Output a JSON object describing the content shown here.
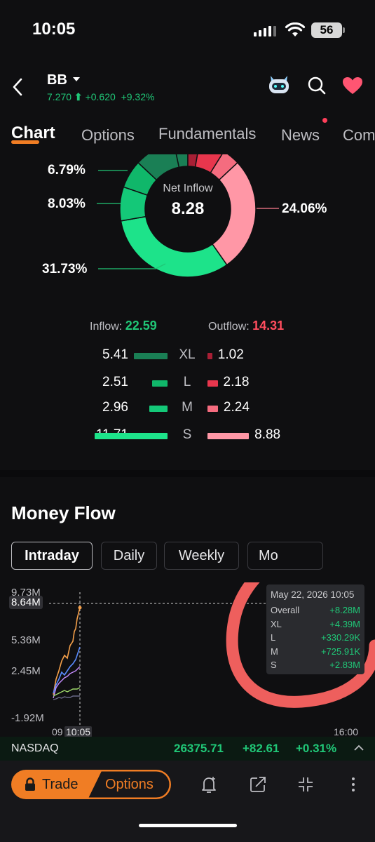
{
  "status": {
    "time": "10:05",
    "battery": "56"
  },
  "header": {
    "ticker": "BB",
    "price": "7.270",
    "change": "+0.620",
    "change_pct": "+9.32%"
  },
  "tabs": [
    {
      "label": "Chart"
    },
    {
      "label": "Options"
    },
    {
      "label": "Fundamentals"
    },
    {
      "label": "News"
    },
    {
      "label": "Com"
    }
  ],
  "donut": {
    "center_label": "Net Inflow",
    "center_value": "8.28",
    "labels": {
      "a": "6.79%",
      "b": "8.03%",
      "c": "31.73%",
      "d": "24.06%"
    }
  },
  "flow": {
    "inflow_label": "Inflow:",
    "inflow_value": "22.59",
    "outflow_label": "Outflow:",
    "outflow_value": "14.31",
    "rows": [
      {
        "in": "5.41",
        "cat": "XL",
        "out": "1.02",
        "in_v": 5.41,
        "out_v": 1.02
      },
      {
        "in": "2.51",
        "cat": "L",
        "out": "2.18",
        "in_v": 2.51,
        "out_v": 2.18
      },
      {
        "in": "2.96",
        "cat": "M",
        "out": "2.24",
        "in_v": 2.96,
        "out_v": 2.24
      },
      {
        "in": "11.71",
        "cat": "S",
        "out": "8.88",
        "in_v": 11.71,
        "out_v": 8.88
      }
    ]
  },
  "money_flow": {
    "title": "Money Flow",
    "periods": [
      "Intraday",
      "Daily",
      "Weekly",
      "Mo"
    ],
    "y_labels": [
      "9.73M",
      "8.64M",
      "5.36M",
      "2.45M",
      "-1.92M"
    ],
    "x_labels": [
      "09",
      "10:05",
      "16:00"
    ],
    "tooltip": {
      "date": "May 22, 2026 10:05",
      "rows": [
        {
          "k": "Overall",
          "v": "+8.28M"
        },
        {
          "k": "XL",
          "v": "+4.39M"
        },
        {
          "k": "L",
          "v": "+330.29K"
        },
        {
          "k": "M",
          "v": "+725.91K"
        },
        {
          "k": "S",
          "v": "+2.83M"
        }
      ]
    }
  },
  "index_bar": {
    "name": "NASDAQ",
    "value": "26375.71",
    "change": "+82.61",
    "pct": "+0.31%"
  },
  "bottom": {
    "trade": "Trade",
    "options": "Options"
  },
  "colors": {
    "accent": "#f07d24",
    "up": "#20c777",
    "down": "#ff4d5e",
    "xl_in": "#1a7f55",
    "l_in": "#10b76a",
    "m_in": "#14c878",
    "s_in": "#1de38a",
    "xl_out": "#a81f35",
    "l_out": "#e8364d",
    "m_out": "#f56c7f",
    "s_out": "#ff97a6"
  }
}
